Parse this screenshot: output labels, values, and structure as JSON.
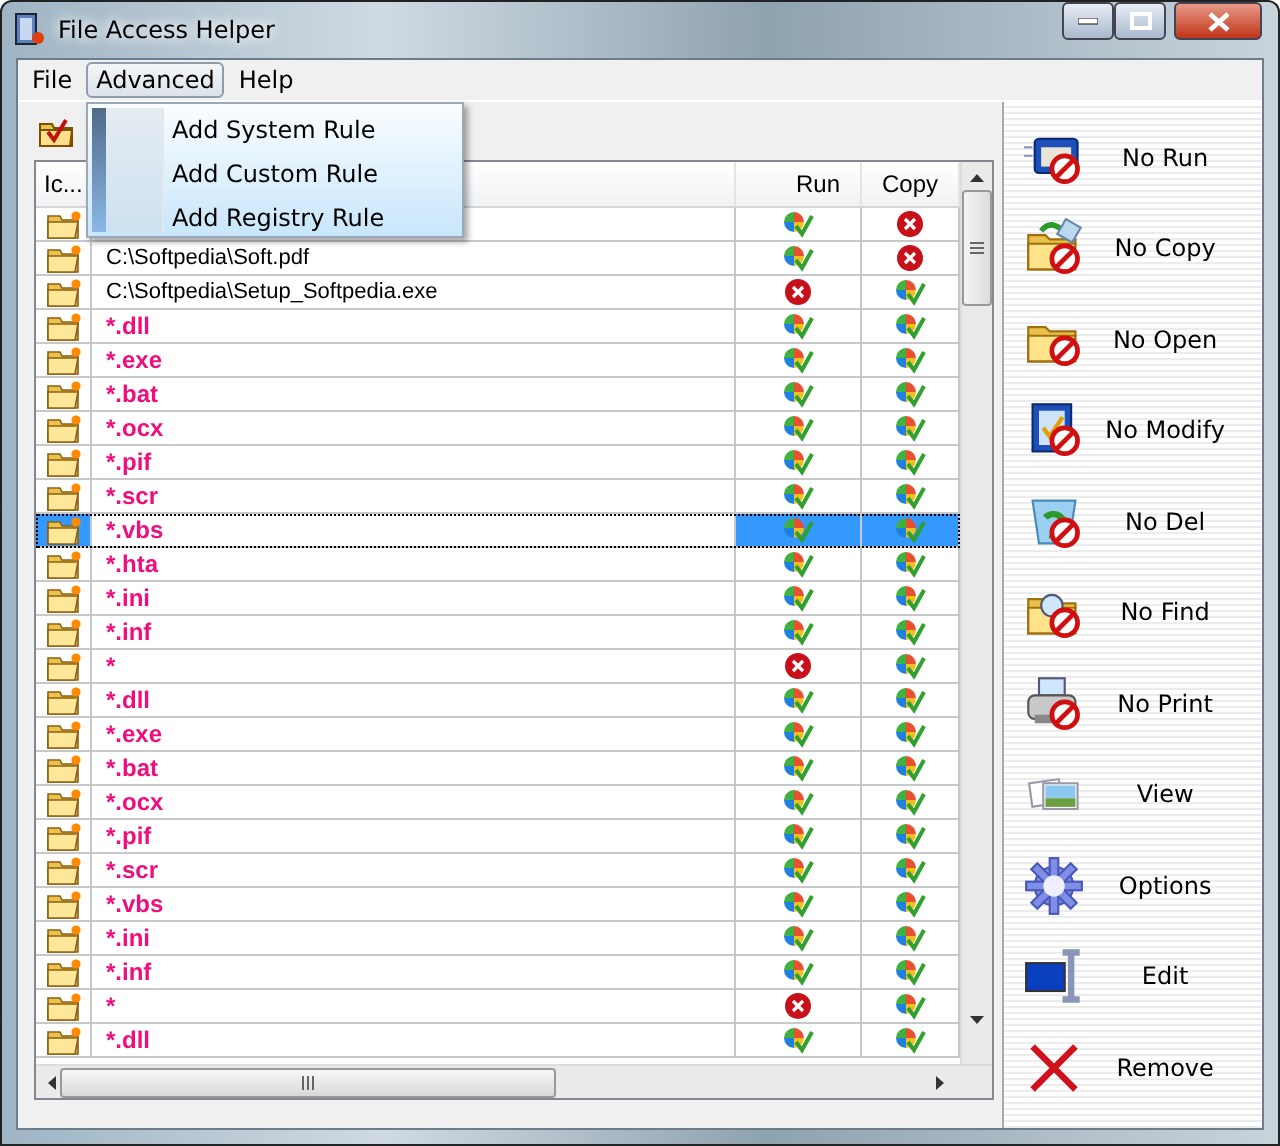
{
  "window": {
    "title": "File Access Helper"
  },
  "menubar": [
    {
      "label": "File",
      "selected": false
    },
    {
      "label": "Advanced",
      "selected": true
    },
    {
      "label": "Help",
      "selected": false
    }
  ],
  "open_menu": {
    "items": [
      {
        "label": "Add System Rule",
        "selected": false
      },
      {
        "label": "Add Custom Rule",
        "selected": false
      },
      {
        "label": "Add Registry Rule",
        "selected": false
      }
    ]
  },
  "table": {
    "columns": [
      {
        "kind": "icon",
        "label": "Ic..."
      },
      {
        "kind": "path"
      },
      {
        "kind": "run",
        "label": "Run"
      },
      {
        "kind": "copy",
        "label": "Copy"
      }
    ],
    "rows": [
      {
        "run_allowed": true,
        "copy_allowed": false,
        "selected": false
      },
      {
        "kind": "file",
        "path": "C:\\Softpedia\\Soft.pdf",
        "run_allowed": true,
        "copy_allowed": false,
        "selected": false
      },
      {
        "kind": "file",
        "path": "C:\\Softpedia\\Setup_Softpedia.exe",
        "run_allowed": false,
        "copy_allowed": true,
        "selected": false
      },
      {
        "kind": "pattern",
        "path": "*.dll",
        "run_allowed": true,
        "copy_allowed": true,
        "selected": false
      },
      {
        "kind": "pattern",
        "path": "*.exe",
        "run_allowed": true,
        "copy_allowed": true,
        "selected": false
      },
      {
        "kind": "pattern",
        "path": "*.bat",
        "run_allowed": true,
        "copy_allowed": true,
        "selected": false
      },
      {
        "kind": "pattern",
        "path": "*.ocx",
        "run_allowed": true,
        "copy_allowed": true,
        "selected": false
      },
      {
        "kind": "pattern",
        "path": "*.pif",
        "run_allowed": true,
        "copy_allowed": true,
        "selected": false
      },
      {
        "kind": "pattern",
        "path": "*.scr",
        "run_allowed": true,
        "copy_allowed": true,
        "selected": false
      },
      {
        "kind": "pattern",
        "path": "*.vbs",
        "run_allowed": true,
        "copy_allowed": true,
        "selected": true
      },
      {
        "kind": "pattern",
        "path": "*.hta",
        "run_allowed": true,
        "copy_allowed": true,
        "selected": false
      },
      {
        "kind": "pattern",
        "path": "*.ini",
        "run_allowed": true,
        "copy_allowed": true,
        "selected": false
      },
      {
        "kind": "pattern",
        "path": "*.inf",
        "run_allowed": true,
        "copy_allowed": true,
        "selected": false
      },
      {
        "kind": "pattern",
        "path": "*",
        "run_allowed": false,
        "copy_allowed": true,
        "selected": false
      },
      {
        "kind": "pattern",
        "path": "*.dll",
        "run_allowed": true,
        "copy_allowed": true,
        "selected": false
      },
      {
        "kind": "pattern",
        "path": "*.exe",
        "run_allowed": true,
        "copy_allowed": true,
        "selected": false
      },
      {
        "kind": "pattern",
        "path": "*.bat",
        "run_allowed": true,
        "copy_allowed": true,
        "selected": false
      },
      {
        "kind": "pattern",
        "path": "*.ocx",
        "run_allowed": true,
        "copy_allowed": true,
        "selected": false
      },
      {
        "kind": "pattern",
        "path": "*.pif",
        "run_allowed": true,
        "copy_allowed": true,
        "selected": false
      },
      {
        "kind": "pattern",
        "path": "*.scr",
        "run_allowed": true,
        "copy_allowed": true,
        "selected": false
      },
      {
        "kind": "pattern",
        "path": "*.vbs",
        "run_allowed": true,
        "copy_allowed": true,
        "selected": false
      },
      {
        "kind": "pattern",
        "path": "*.ini",
        "run_allowed": true,
        "copy_allowed": true,
        "selected": false
      },
      {
        "kind": "pattern",
        "path": "*.inf",
        "run_allowed": true,
        "copy_allowed": true,
        "selected": false
      },
      {
        "kind": "pattern",
        "path": "*",
        "run_allowed": false,
        "copy_allowed": true,
        "selected": false
      },
      {
        "kind": "pattern",
        "path": "*.dll",
        "run_allowed": true,
        "copy_allowed": true,
        "selected": false
      }
    ]
  },
  "sidebar": [
    {
      "kind": "run",
      "label": "No Run"
    },
    {
      "kind": "copy",
      "label": "No Copy"
    },
    {
      "kind": "open",
      "label": "No Open"
    },
    {
      "kind": "modify",
      "label": "No Modify"
    },
    {
      "kind": "del",
      "label": "No Del"
    },
    {
      "kind": "find",
      "label": "No Find"
    },
    {
      "kind": "print",
      "label": "No Print"
    },
    {
      "kind": "view",
      "label": "View"
    },
    {
      "kind": "options",
      "label": "Options"
    },
    {
      "kind": "edit",
      "label": "Edit"
    },
    {
      "kind": "remove",
      "label": "Remove"
    }
  ]
}
